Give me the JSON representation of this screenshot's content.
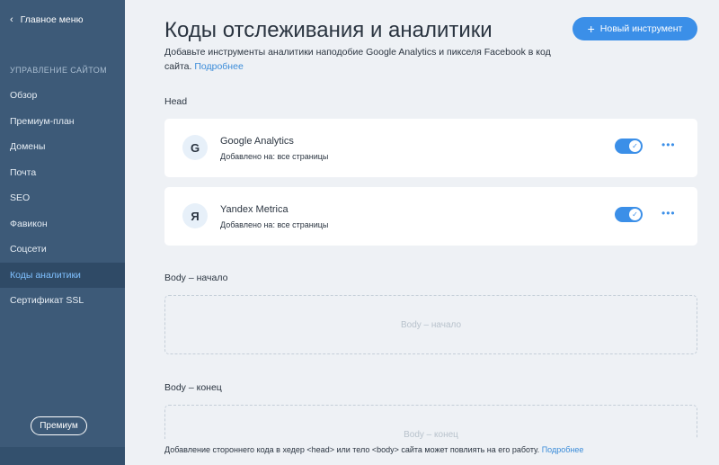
{
  "sidebar": {
    "back_label": "Главное меню",
    "section_title": "УПРАВЛЕНИЕ САЙТОМ",
    "items": [
      {
        "label": "Обзор"
      },
      {
        "label": "Премиум-план"
      },
      {
        "label": "Домены"
      },
      {
        "label": "Почта"
      },
      {
        "label": "SEO"
      },
      {
        "label": "Фавикон"
      },
      {
        "label": "Соцсети"
      },
      {
        "label": "Коды аналитики",
        "active": true
      },
      {
        "label": "Сертификат SSL"
      }
    ],
    "premium_button": "Премиум"
  },
  "header": {
    "title": "Коды отслеживания и аналитики",
    "subtitle": "Добавьте инструменты аналитики наподобие Google Analytics и пикселя Facebook в код сайта.",
    "subtitle_link": "Подробнее",
    "new_button": "Новый инструмент"
  },
  "sections": {
    "head_label": "Head",
    "body_start_label": "Body – начало",
    "body_start_placeholder": "Body – начало",
    "body_end_label": "Body – конец",
    "body_end_placeholder": "Body – конец"
  },
  "tools": [
    {
      "logo": "G",
      "name": "Google Analytics",
      "meta": "Добавлено на: все страницы",
      "enabled": true
    },
    {
      "logo": "Я",
      "name": "Yandex Metrica",
      "meta": "Добавлено на: все страницы",
      "enabled": true
    }
  ],
  "footer": {
    "text": "Добавление стороннего кода в хедер <head> или тело <body> сайта может повлиять на его работу.",
    "link": "Подробнее"
  },
  "colors": {
    "sidebar_bg": "#3d5a78",
    "accent": "#3b8fe8",
    "active_link": "#7fc0ff"
  }
}
